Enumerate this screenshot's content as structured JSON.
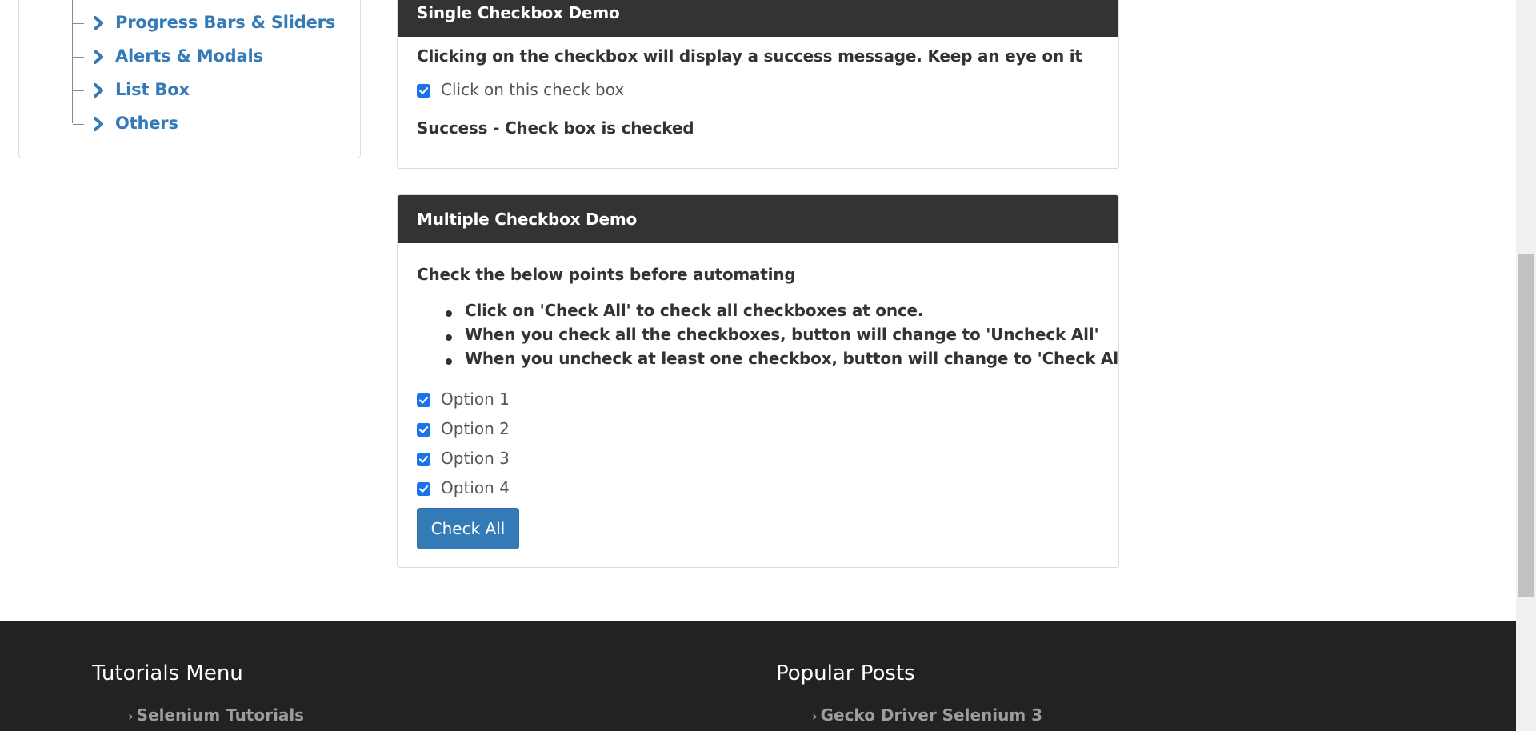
{
  "sidebar": {
    "items": [
      {
        "label": "Progress Bars & Sliders"
      },
      {
        "label": "Alerts & Modals"
      },
      {
        "label": "List Box"
      },
      {
        "label": "Others"
      }
    ]
  },
  "single_checkbox": {
    "heading": "Single Checkbox Demo",
    "description": "Clicking on the checkbox will display a success message. Keep an eye on it",
    "checkbox_label": "Click on this check box",
    "checkbox_checked": true,
    "success_message": "Success - Check box is checked"
  },
  "multiple_checkbox": {
    "heading": "Multiple Checkbox Demo",
    "intro": "Check the below points before automating",
    "points": [
      "Click on 'Check All' to check all checkboxes at once.",
      "When you check all the checkboxes, button will change to 'Uncheck All'",
      "When you uncheck at least one checkbox, button will change to 'Check All'"
    ],
    "options": [
      {
        "label": "Option 1",
        "checked": true
      },
      {
        "label": "Option 2",
        "checked": true
      },
      {
        "label": "Option 3",
        "checked": true
      },
      {
        "label": "Option 4",
        "checked": true
      }
    ],
    "button_label": "Check All"
  },
  "footer": {
    "tutorials_title": "Tutorials Menu",
    "tutorials_link": "Selenium Tutorials",
    "popular_title": "Popular Posts",
    "popular_link": "Gecko Driver Selenium 3"
  },
  "colors": {
    "panel_heading_bg": "#333333",
    "link_blue": "#337ab7",
    "checkbox_blue": "#1a73e8",
    "footer_bg": "#222222"
  }
}
